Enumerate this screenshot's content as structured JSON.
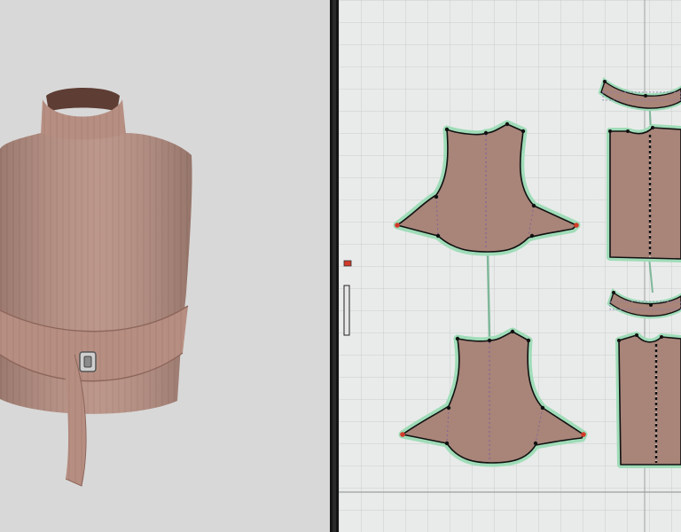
{
  "colors": {
    "fabric": "#b58f83",
    "fabric_dark": "#9c7367",
    "fabric_light": "#c9a294",
    "piece_fill": "#a88479",
    "piece_outline": "#111111",
    "seam_glow": "#9fdcb8",
    "grid_line": "#c9cccb",
    "grid_bg": "#e9ebea",
    "viewport_bg": "#d8d8d8",
    "splitter": "#141414",
    "point_red": "#d23a2a"
  },
  "icons": {
    "buckle": "buckle-icon",
    "zoom_handle": "zoom-handle-icon"
  }
}
